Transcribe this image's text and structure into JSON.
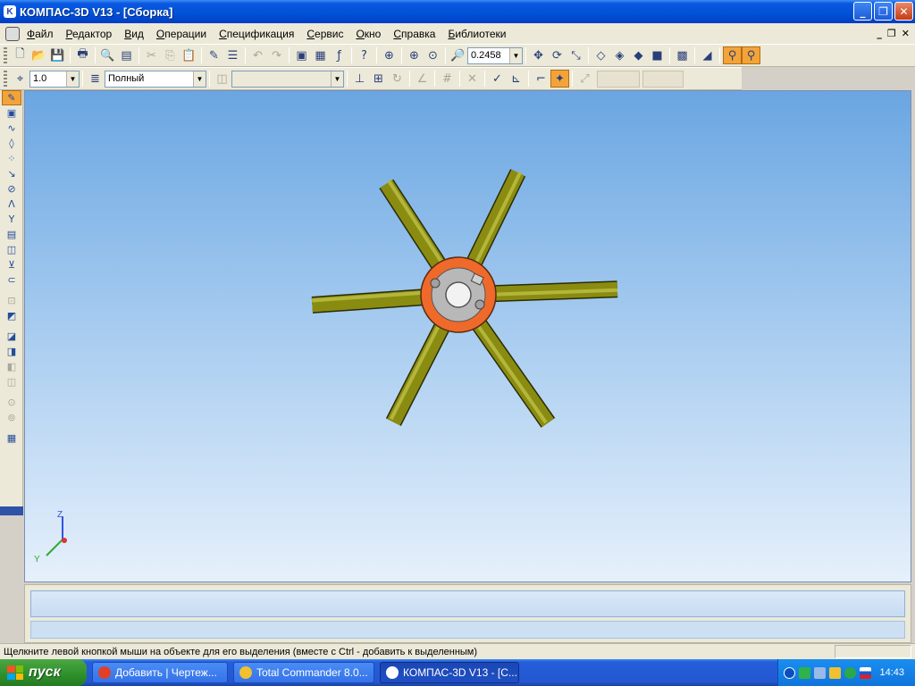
{
  "window": {
    "app_icon": "Κ",
    "title": "КОМПАС-3D V13 - [Сборка]",
    "minimize_glyph": "_",
    "restore_glyph": "❐",
    "close_glyph": "✕"
  },
  "menu": {
    "items": [
      "Файл",
      "Редактор",
      "Вид",
      "Операции",
      "Спецификация",
      "Сервис",
      "Окно",
      "Справка",
      "Библиотеки"
    ],
    "mdi_minimize": "_",
    "mdi_restore": "❐",
    "mdi_close": "✕"
  },
  "toolbar": {
    "zoom_value": "0.2458"
  },
  "props_toolbar": {
    "scale_value": "1.0",
    "line_style": "Полный",
    "disabled_combo": ""
  },
  "status": {
    "message": "Щелкните левой кнопкой мыши на объекте для его выделения (вместе с Ctrl - добавить к выделенным)"
  },
  "axes": {
    "z_label": "Z",
    "y_label": "Y"
  },
  "taskbar": {
    "start_label": "пуск",
    "tasks": [
      {
        "label": "Добавить | Чертеж...",
        "icon_color": "#e0402a"
      },
      {
        "label": "Total Commander 8.0...",
        "icon_color": "#f0c030"
      },
      {
        "label": "КОМПАС-3D V13 - [С...",
        "icon_color": "#ffffff"
      }
    ],
    "clock": "14:43"
  },
  "colors": {
    "spoke": "#8a8c12",
    "hub_ring": "#ef6a2a",
    "hub_center": "#b8b8b8"
  }
}
